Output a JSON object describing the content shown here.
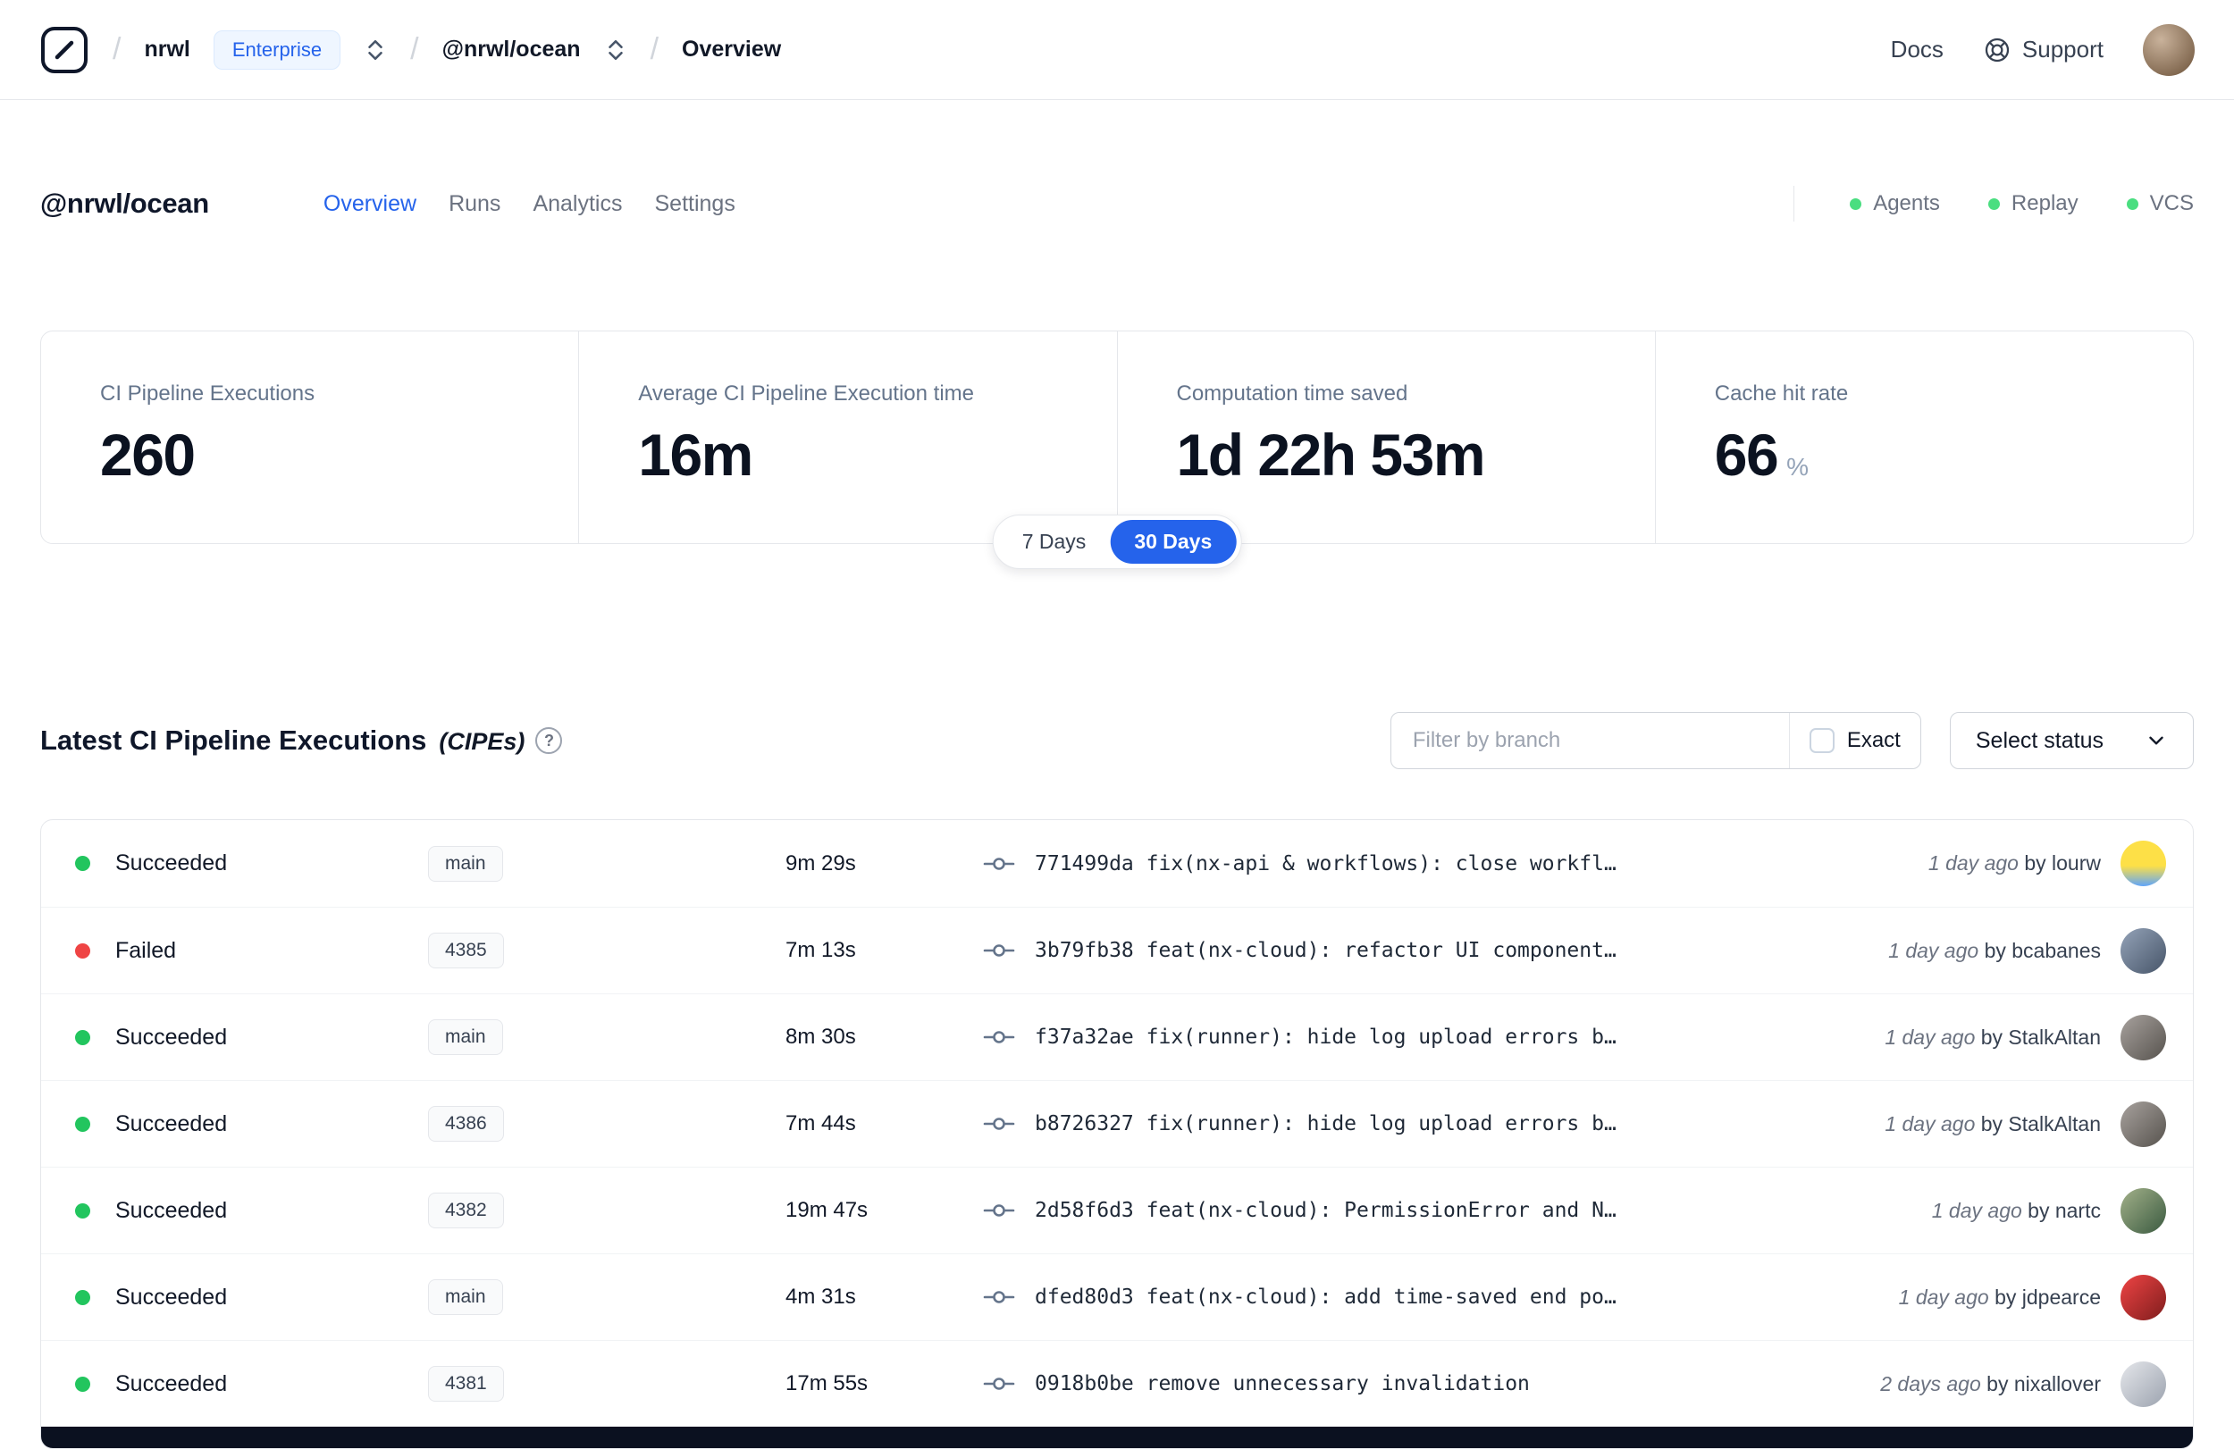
{
  "colors": {
    "accent": "#2563eb",
    "success_green": "#22c55e",
    "fail_red": "#ef4444",
    "indicator_green": "#4ade80"
  },
  "navbar": {
    "separator": "/",
    "org": "nrwl",
    "org_badge": "Enterprise",
    "workspace": "@nrwl/ocean",
    "page": "Overview",
    "docs": "Docs",
    "support": "Support",
    "avatar_color": "radial-gradient(circle at 35% 30%, #c9b29b, #6b5138)"
  },
  "header": {
    "title": "@nrwl/ocean",
    "tabs": [
      {
        "label": "Overview",
        "active": true
      },
      {
        "label": "Runs",
        "active": false
      },
      {
        "label": "Analytics",
        "active": false
      },
      {
        "label": "Settings",
        "active": false
      }
    ],
    "indicators": [
      {
        "label": "Agents"
      },
      {
        "label": "Replay"
      },
      {
        "label": "VCS"
      }
    ]
  },
  "stats": {
    "cards": [
      {
        "label": "CI Pipeline Executions",
        "value": "260"
      },
      {
        "label": "Average CI Pipeline Execution time",
        "value": "16m"
      },
      {
        "label": "Computation time saved",
        "value": "1d 22h 53m"
      },
      {
        "label": "Cache hit rate",
        "value": "66",
        "suffix": "%"
      }
    ],
    "range": {
      "options": [
        "7 Days",
        "30 Days"
      ],
      "selected": "30 Days"
    }
  },
  "cipes": {
    "title": "Latest CI Pipeline Executions",
    "suffix": "(CIPEs)",
    "help_glyph": "?",
    "filter_placeholder": "Filter by branch",
    "exact_label": "Exact",
    "exact_checked": false,
    "select_status_label": "Select status",
    "rows": [
      {
        "status": "Succeeded",
        "color": "green",
        "branch": "main",
        "duration": "9m 29s",
        "commit": "771499da fix(nx-api & workflows): close workfl…",
        "time": "1 day ago",
        "author": "by lourw",
        "avatar": "linear-gradient(180deg,#fde047 55%,#60a5fa 100%)"
      },
      {
        "status": "Failed",
        "color": "red",
        "branch": "4385",
        "duration": "7m 13s",
        "commit": "3b79fb38 feat(nx-cloud): refactor UI component…",
        "time": "1 day ago",
        "author": "by bcabanes",
        "avatar": "linear-gradient(135deg,#94a3b8,#475569)"
      },
      {
        "status": "Succeeded",
        "color": "green",
        "branch": "main",
        "duration": "8m 30s",
        "commit": "f37a32ae fix(runner): hide log upload errors b…",
        "time": "1 day ago",
        "author": "by StalkAltan",
        "avatar": "linear-gradient(135deg,#a8a29e,#57534e)"
      },
      {
        "status": "Succeeded",
        "color": "green",
        "branch": "4386",
        "duration": "7m 44s",
        "commit": "b8726327 fix(runner): hide log upload errors b…",
        "time": "1 day ago",
        "author": "by StalkAltan",
        "avatar": "linear-gradient(135deg,#a8a29e,#57534e)"
      },
      {
        "status": "Succeeded",
        "color": "green",
        "branch": "4382",
        "duration": "19m 47s",
        "commit": "2d58f6d3 feat(nx-cloud): PermissionError and N…",
        "time": "1 day ago",
        "author": "by nartc",
        "avatar": "linear-gradient(135deg,#a3b18a,#3a5a40)"
      },
      {
        "status": "Succeeded",
        "color": "green",
        "branch": "main",
        "duration": "4m 31s",
        "commit": "dfed80d3 feat(nx-cloud): add time-saved end po…",
        "time": "1 day ago",
        "author": "by jdpearce",
        "avatar": "linear-gradient(135deg,#ef4444,#7f1d1d)"
      },
      {
        "status": "Succeeded",
        "color": "green",
        "branch": "4381",
        "duration": "17m 55s",
        "commit": "0918b0be remove unnecessary invalidation",
        "time": "2 days ago",
        "author": "by nixallover",
        "avatar": "linear-gradient(135deg,#e5e7eb,#9ca3af)"
      }
    ]
  }
}
